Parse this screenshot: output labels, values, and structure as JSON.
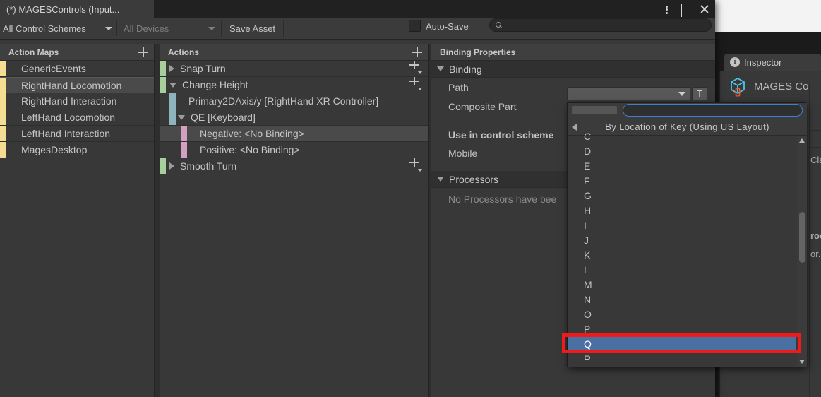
{
  "window": {
    "tab_title": "(*) MAGESControls (Input...",
    "buttons": {
      "kebab": "kebab-menu",
      "maximize": "maximize",
      "close": "close"
    }
  },
  "toolbar": {
    "control_schemes": "All Control Schemes",
    "devices": "All Devices",
    "save_asset": "Save Asset",
    "auto_save": "Auto-Save",
    "search_placeholder": "",
    "search_value": ""
  },
  "action_maps": {
    "header": "Action Maps",
    "add_label": "+",
    "strip_color": "#f5dd92",
    "items": [
      {
        "label": "GenericEvents",
        "selected": false
      },
      {
        "label": "RightHand Locomotion",
        "selected": true
      },
      {
        "label": "RightHand Interaction",
        "selected": false
      },
      {
        "label": "LeftHand Locomotion",
        "selected": false
      },
      {
        "label": "LeftHand Interaction",
        "selected": false
      },
      {
        "label": "MagesDesktop",
        "selected": false
      }
    ]
  },
  "actions": {
    "header": "Actions",
    "add_label": "+",
    "colors": {
      "action": "#a8cf9b",
      "binding": "#8fb3bd",
      "composite": "#d4a0c0"
    },
    "rows": [
      {
        "label": "Snap Turn",
        "kind": "action",
        "indent": 0,
        "twisty": "closed",
        "plus": true,
        "selected": false
      },
      {
        "label": "Change Height",
        "kind": "action",
        "indent": 0,
        "twisty": "open",
        "plus": true,
        "selected": false
      },
      {
        "label": "Primary2DAxis/y [RightHand XR Controller]",
        "kind": "binding",
        "indent": 1,
        "twisty": "none",
        "plus": false,
        "selected": false
      },
      {
        "label": "QE [Keyboard]",
        "kind": "binding",
        "indent": 1,
        "twisty": "open",
        "plus": false,
        "selected": false
      },
      {
        "label": "Negative: <No Binding>",
        "kind": "composite",
        "indent": 2,
        "twisty": "none",
        "plus": false,
        "selected": true
      },
      {
        "label": "Positive: <No Binding>",
        "kind": "composite",
        "indent": 2,
        "twisty": "none",
        "plus": false,
        "selected": false
      },
      {
        "label": "Smooth Turn",
        "kind": "action",
        "indent": 0,
        "twisty": "closed",
        "plus": true,
        "selected": false
      }
    ]
  },
  "binding_properties": {
    "header": "Binding Properties",
    "section_binding": "Binding",
    "path_label": "Path",
    "path_value": "",
    "path_t_button": "T",
    "composite_part_label": "Composite Part",
    "use_in_control_scheme_label": "Use in control scheme",
    "mobile_label": "Mobile",
    "section_processors": "Processors",
    "processors_empty": "No Processors have bee"
  },
  "path_dropdown": {
    "search_value": "",
    "back_label": "back-arrow",
    "title": "By Location of Key (Using US Layout)",
    "items": [
      "C",
      "D",
      "E",
      "F",
      "G",
      "H",
      "I",
      "J",
      "K",
      "L",
      "M",
      "N",
      "O",
      "P",
      "Q",
      "R"
    ],
    "selected": "Q",
    "highlight_color": "#4a6fa3",
    "annotation_color": "#ef1a1a"
  },
  "inspector": {
    "tab_label": "Inspector",
    "object_name": "MAGES Co",
    "fragments": [
      "Cla",
      "roc",
      "or.S"
    ]
  }
}
